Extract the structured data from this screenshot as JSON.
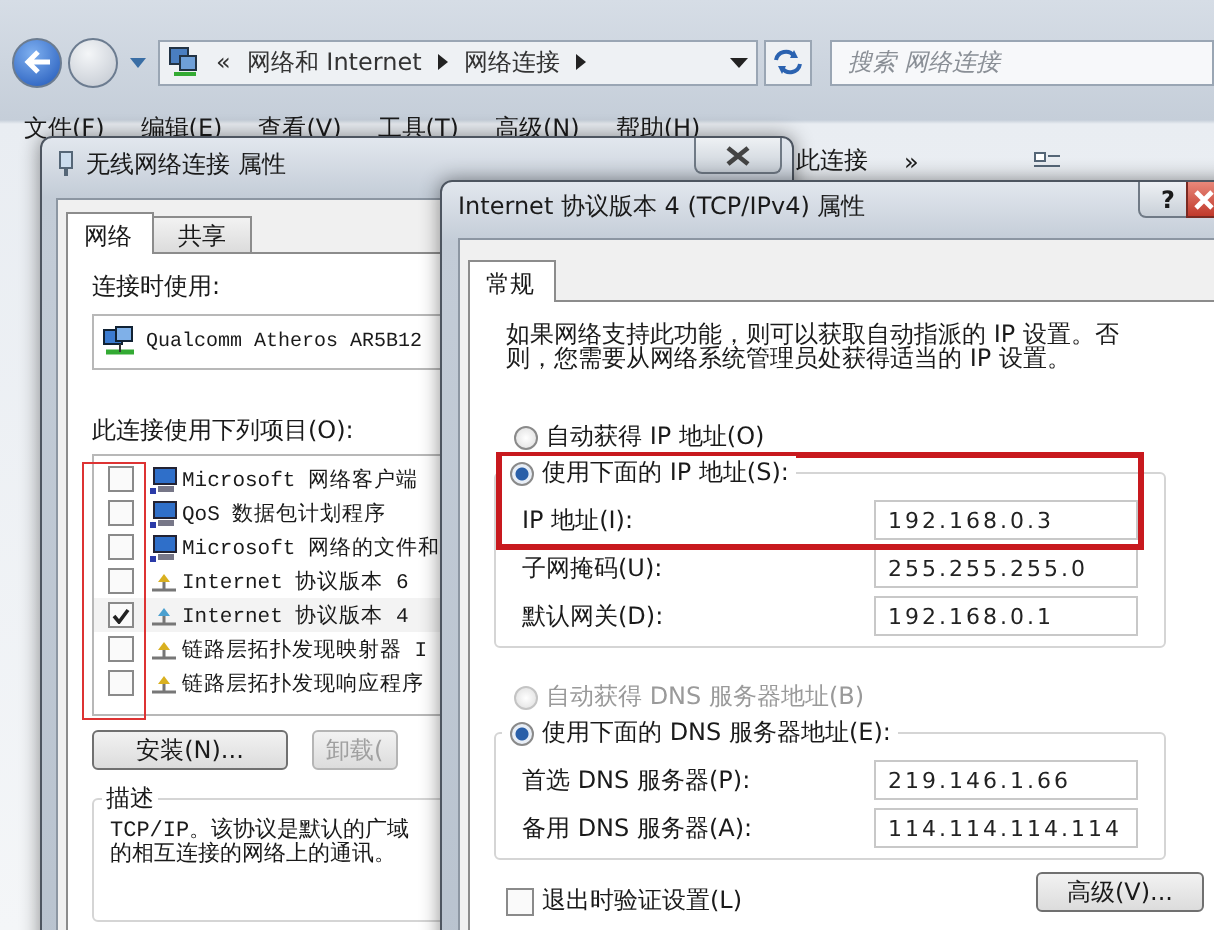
{
  "explorer": {
    "address_prefix": "«",
    "address": [
      "网络和 Internet",
      "网络连接"
    ],
    "search": {
      "placeholder": "搜索 网络连接"
    },
    "menu": [
      "文件(F)",
      "编辑(E)",
      "查看(V)",
      "工具(T)",
      "高级(N)",
      "帮助(H)"
    ],
    "toolbar": {
      "label": "此连接",
      "more": "»"
    }
  },
  "dialog_1": {
    "title": "无线网络连接 属性",
    "tabs": [
      {
        "label": "网络",
        "selected": true
      },
      {
        "label": "共享",
        "selected": false
      }
    ],
    "connect_using_label": "连接时使用:",
    "adapter": "Qualcomm Atheros AR5B12",
    "items_label": "此连接使用下列项目(O):",
    "items": [
      {
        "label": "Microsoft 网络客户端",
        "checked": false
      },
      {
        "label": "QoS 数据包计划程序",
        "checked": false
      },
      {
        "label": "Microsoft 网络的文件和",
        "checked": false
      },
      {
        "label": "Internet 协议版本 6",
        "checked": false
      },
      {
        "label": "Internet 协议版本 4",
        "checked": true
      },
      {
        "label": "链路层拓扑发现映射器 I",
        "checked": false
      },
      {
        "label": "链路层拓扑发现响应程序",
        "checked": false
      }
    ],
    "buttons": [
      "安装(N)...",
      "卸载("
    ],
    "description": {
      "title": "描述",
      "lines": [
        "TCP/IP。该协议是默认的广域",
        "的相互连接的网络上的通讯。"
      ]
    }
  },
  "dialog_2": {
    "title": "Internet 协议版本 4 (TCP/IPv4) 属性",
    "help": "?",
    "tabs": [
      {
        "label": "常规",
        "selected": true
      }
    ],
    "intro": "如果网络支持此功能，则可以获取自动指派的 IP 设置。否则，您需要从网络系统管理员处获得适当的 IP 设置。",
    "ip_modes": [
      {
        "label": "自动获得 IP 地址(O)",
        "selected": false,
        "disabled": false
      },
      {
        "label": "使用下面的 IP 地址(S):",
        "selected": true,
        "disabled": false
      }
    ],
    "ip_fields": [
      {
        "label": "IP 地址(I):",
        "value": "192.168.0.3"
      },
      {
        "label": "子网掩码(U):",
        "value": "255.255.255.0"
      },
      {
        "label": "默认网关(D):",
        "value": "192.168.0.1"
      }
    ],
    "dns_modes": [
      {
        "label": "自动获得 DNS 服务器地址(B)",
        "selected": false,
        "disabled": true
      },
      {
        "label": "使用下面的 DNS 服务器地址(E):",
        "selected": true,
        "disabled": false
      }
    ],
    "dns_fields": [
      {
        "label": "首选 DNS 服务器(P):",
        "value": "219.146.1.66"
      },
      {
        "label": "备用 DNS 服务器(A):",
        "value": "114.114.114.114"
      }
    ],
    "validate": {
      "label": "退出时验证设置(L)",
      "checked": false
    },
    "advanced_button": "高级(V)..."
  }
}
